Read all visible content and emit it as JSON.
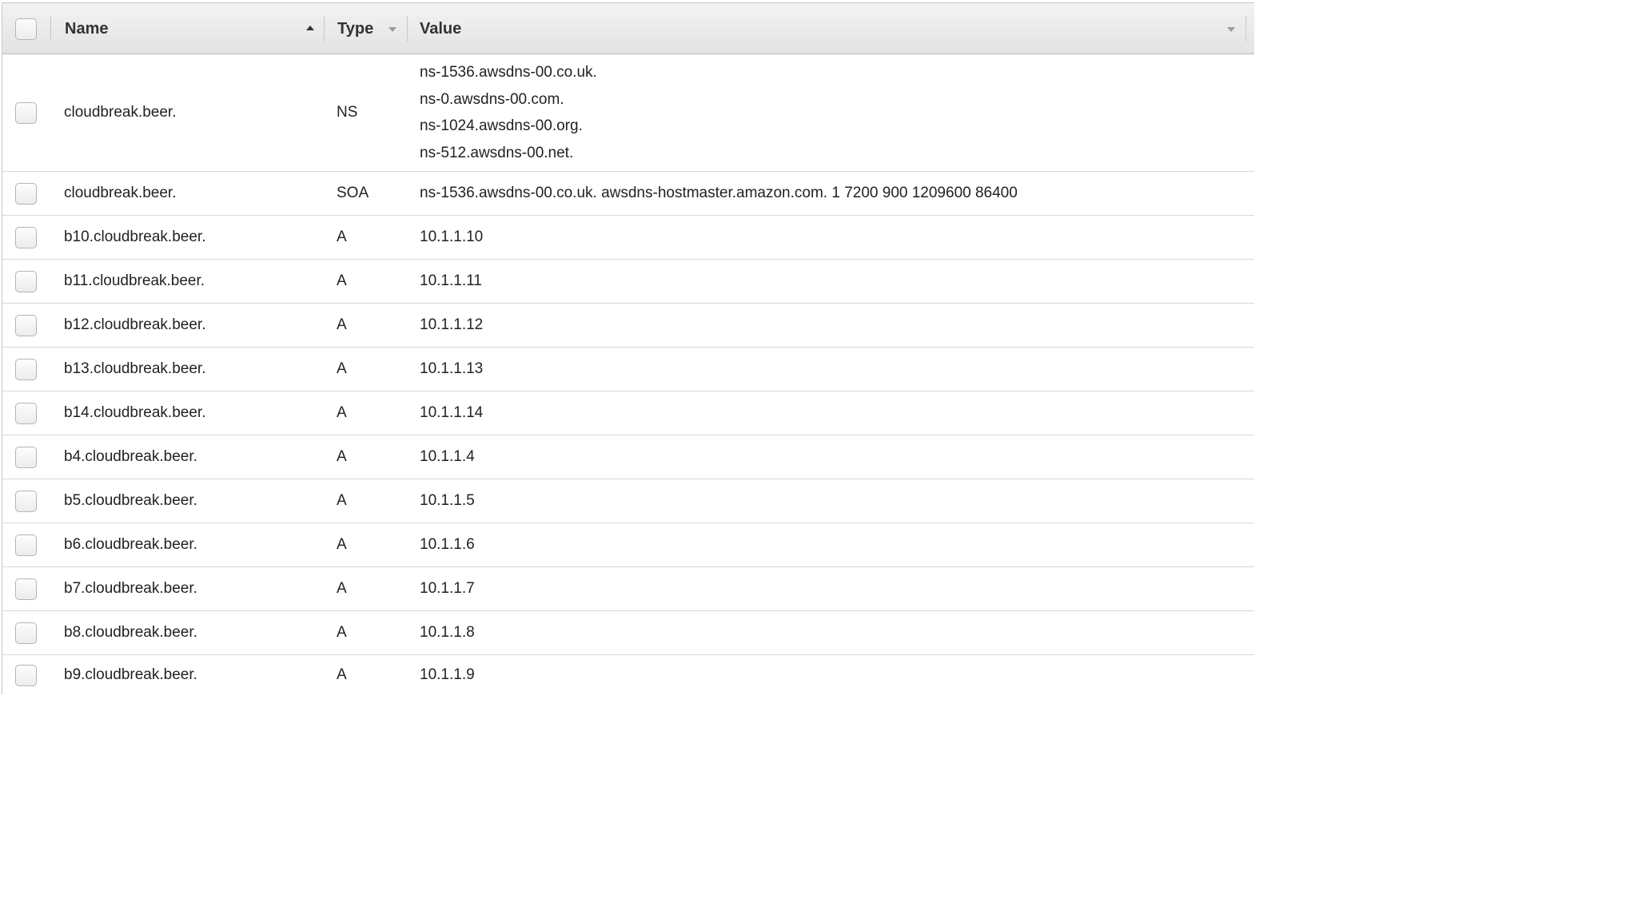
{
  "columns": {
    "name": "Name",
    "type": "Type",
    "value": "Value"
  },
  "records": [
    {
      "name": "cloudbreak.beer.",
      "type": "NS",
      "values": [
        "ns-1536.awsdns-00.co.uk.",
        "ns-0.awsdns-00.com.",
        "ns-1024.awsdns-00.org.",
        "ns-512.awsdns-00.net."
      ]
    },
    {
      "name": "cloudbreak.beer.",
      "type": "SOA",
      "values": [
        "ns-1536.awsdns-00.co.uk. awsdns-hostmaster.amazon.com. 1 7200 900 1209600 86400"
      ]
    },
    {
      "name": "b10.cloudbreak.beer.",
      "type": "A",
      "values": [
        "10.1.1.10"
      ]
    },
    {
      "name": "b11.cloudbreak.beer.",
      "type": "A",
      "values": [
        "10.1.1.11"
      ]
    },
    {
      "name": "b12.cloudbreak.beer.",
      "type": "A",
      "values": [
        "10.1.1.12"
      ]
    },
    {
      "name": "b13.cloudbreak.beer.",
      "type": "A",
      "values": [
        "10.1.1.13"
      ]
    },
    {
      "name": "b14.cloudbreak.beer.",
      "type": "A",
      "values": [
        "10.1.1.14"
      ]
    },
    {
      "name": "b4.cloudbreak.beer.",
      "type": "A",
      "values": [
        "10.1.1.4"
      ]
    },
    {
      "name": "b5.cloudbreak.beer.",
      "type": "A",
      "values": [
        "10.1.1.5"
      ]
    },
    {
      "name": "b6.cloudbreak.beer.",
      "type": "A",
      "values": [
        "10.1.1.6"
      ]
    },
    {
      "name": "b7.cloudbreak.beer.",
      "type": "A",
      "values": [
        "10.1.1.7"
      ]
    },
    {
      "name": "b8.cloudbreak.beer.",
      "type": "A",
      "values": [
        "10.1.1.8"
      ]
    },
    {
      "name": "b9.cloudbreak.beer.",
      "type": "A",
      "values": [
        "10.1.1.9"
      ]
    }
  ]
}
